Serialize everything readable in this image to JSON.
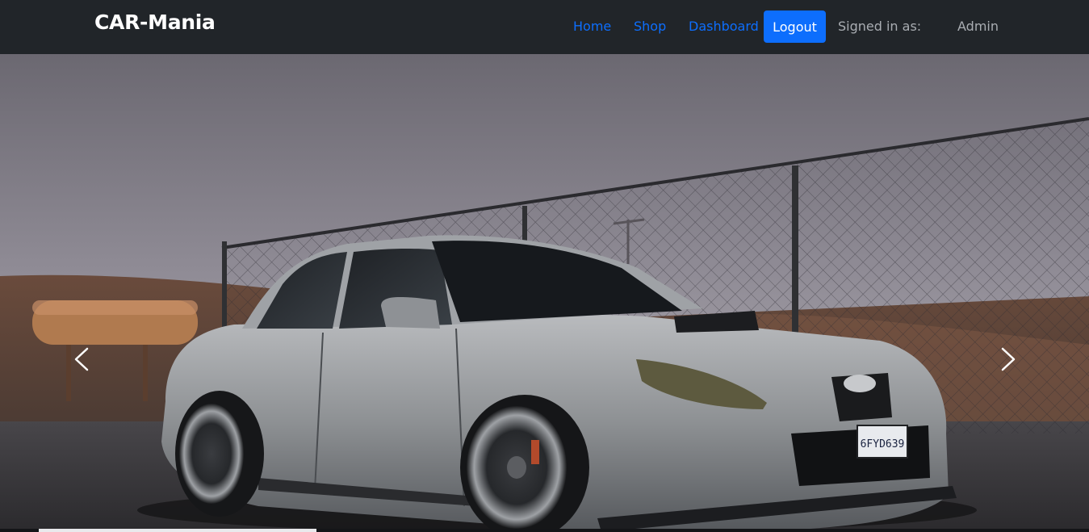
{
  "navbar": {
    "brand": "CAR-Mania",
    "links": [
      {
        "label": "Home"
      },
      {
        "label": "Shop"
      },
      {
        "label": "Dashboard"
      }
    ],
    "logout_label": "Logout",
    "signed_in_label": "Signed in as:",
    "username": "Admin"
  },
  "carousel": {
    "image": "car-photo",
    "license_plate": "6FYD639",
    "prev_icon": "chevron-left-icon",
    "next_icon": "chevron-right-icon"
  },
  "colors": {
    "navbar_bg": "#212529",
    "link": "#0d6efd",
    "button_bg": "#0d6efd",
    "muted_text": "#a9adb2"
  }
}
